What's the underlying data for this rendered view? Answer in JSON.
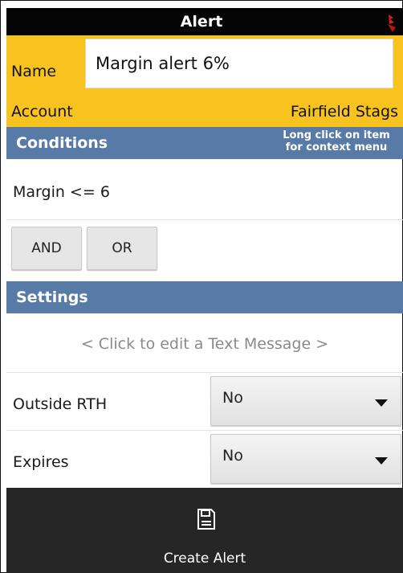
{
  "titlebar": {
    "title": "Alert",
    "icon": "flag-icon"
  },
  "name": {
    "label": "Name",
    "value": "Margin alert 6%"
  },
  "account": {
    "label": "Account",
    "value": "Fairfield Stags"
  },
  "conditions": {
    "header": "Conditions",
    "hint": "Long click on item for context menu",
    "items": [
      "Margin <= 6"
    ],
    "and_label": "AND",
    "or_label": "OR"
  },
  "settings": {
    "header": "Settings",
    "text_message_placeholder": "< Click to edit a Text Message >",
    "outside_rth": {
      "label": "Outside RTH",
      "value": "No"
    },
    "expires": {
      "label": "Expires",
      "value": "No"
    }
  },
  "bottom": {
    "icon": "save-icon",
    "label": "Create Alert"
  },
  "colors": {
    "titlebar": "#050505",
    "accent_yellow": "#f9c31f",
    "section_header": "#587aa6",
    "bottom_bar": "#262626"
  }
}
